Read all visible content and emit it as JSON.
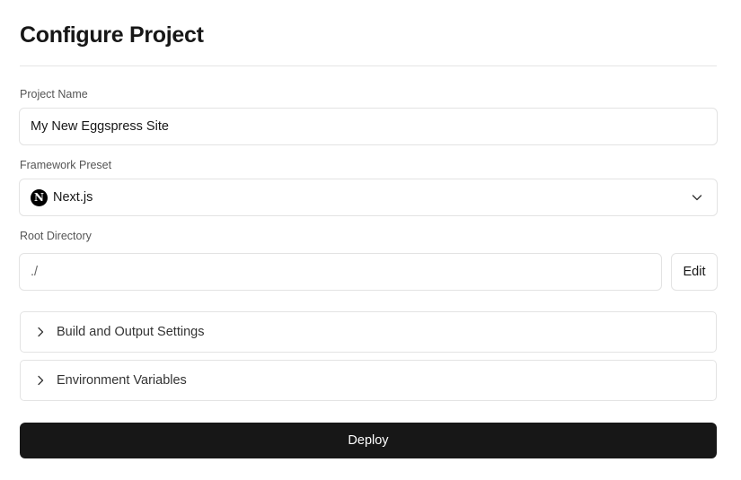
{
  "page": {
    "title": "Configure Project"
  },
  "project_name": {
    "label": "Project Name",
    "value": "My New Eggspress Site"
  },
  "framework": {
    "label": "Framework Preset",
    "value": "Next.js",
    "logo_letter": "N",
    "icon": "chevron-down-icon"
  },
  "root_directory": {
    "label": "Root Directory",
    "value": "./",
    "edit_label": "Edit"
  },
  "sections": [
    {
      "label": "Build and Output Settings",
      "icon": "chevron-right-icon"
    },
    {
      "label": "Environment Variables",
      "icon": "chevron-right-icon"
    }
  ],
  "deploy": {
    "label": "Deploy"
  }
}
